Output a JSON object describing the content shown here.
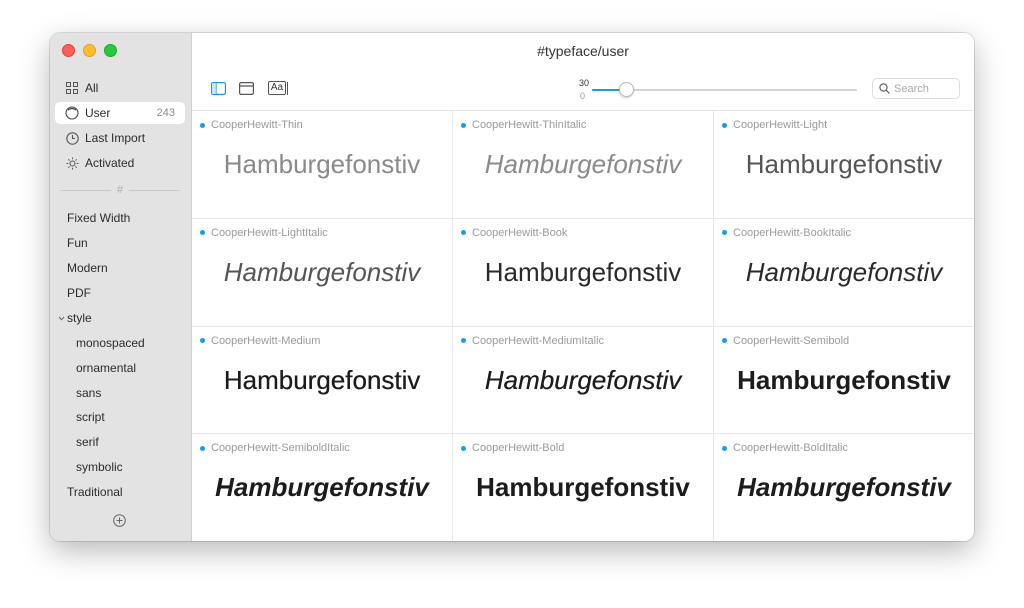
{
  "window": {
    "title": "#typeface/user"
  },
  "colors": {
    "accent": "#1a9be6",
    "sidebar_bg": "#e3e3e3",
    "selected_bg": "#ffffff"
  },
  "sidebar": {
    "library": [
      {
        "label": "All",
        "icon": "grid-icon"
      },
      {
        "label": "User",
        "icon": "user-collection-icon",
        "count": "243",
        "selected": true
      },
      {
        "label": "Last Import",
        "icon": "clock-icon"
      },
      {
        "label": "Activated",
        "icon": "sun-icon"
      }
    ],
    "separator_symbol": "#",
    "tags": [
      {
        "label": "Fixed Width"
      },
      {
        "label": "Fun"
      },
      {
        "label": "Modern"
      },
      {
        "label": "PDF"
      }
    ],
    "group": {
      "label": "style",
      "expanded": true,
      "children": [
        "monospaced",
        "ornamental",
        "sans",
        "script",
        "serif",
        "symbolic"
      ]
    },
    "tags_after": [
      {
        "label": "Traditional"
      }
    ],
    "add_icon": "plus-circle-icon"
  },
  "toolbar": {
    "buttons": [
      {
        "name": "sidebar-toggle-icon",
        "active": true
      },
      {
        "name": "preview-panel-icon",
        "active": false
      },
      {
        "name": "text-sample-icon",
        "label": "Aa"
      }
    ],
    "size_slider": {
      "value": 30,
      "min_label": "0",
      "max_label": "30",
      "fraction": 0.13
    },
    "search": {
      "placeholder": "Search"
    }
  },
  "fonts": {
    "sample_text": "Hamburgefonstiv",
    "items": [
      {
        "name": "CooperHewitt-Thin",
        "weight": 100,
        "italic": false
      },
      {
        "name": "CooperHewitt-ThinItalic",
        "weight": 100,
        "italic": true
      },
      {
        "name": "CooperHewitt-Light",
        "weight": 300,
        "italic": false
      },
      {
        "name": "CooperHewitt-LightItalic",
        "weight": 300,
        "italic": true
      },
      {
        "name": "CooperHewitt-Book",
        "weight": 400,
        "italic": false
      },
      {
        "name": "CooperHewitt-BookItalic",
        "weight": 400,
        "italic": true
      },
      {
        "name": "CooperHewitt-Medium",
        "weight": 500,
        "italic": false
      },
      {
        "name": "CooperHewitt-MediumItalic",
        "weight": 500,
        "italic": true
      },
      {
        "name": "CooperHewitt-Semibold",
        "weight": 600,
        "italic": false
      },
      {
        "name": "CooperHewitt-SemiboldItalic",
        "weight": 600,
        "italic": true
      },
      {
        "name": "CooperHewitt-Bold",
        "weight": 700,
        "italic": false
      },
      {
        "name": "CooperHewitt-BoldItalic",
        "weight": 700,
        "italic": true
      }
    ]
  }
}
